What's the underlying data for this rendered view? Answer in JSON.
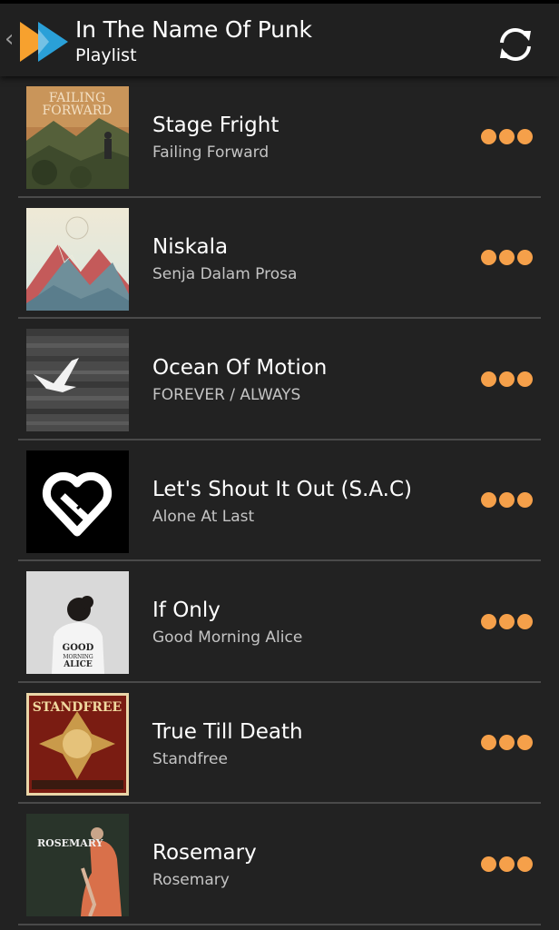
{
  "header": {
    "title": "In The Name Of Punk",
    "subtitle": "Playlist",
    "up_caret": "‹",
    "logo_icon": "app-logo-icon",
    "sync_icon": "sync-icon"
  },
  "colors": {
    "background": "#222222",
    "action_bar": "#202020",
    "accent_orange": "#f5a04a",
    "logo_orange": "#f7a12e",
    "logo_blue": "#2aa0d8",
    "divider": "#4a4a4a"
  },
  "tracks": [
    {
      "title": "Stage Fright",
      "artist": "Failing Forward",
      "art_text": [
        "FAILING",
        "FORWARD"
      ],
      "more_icon": "more-dots-icon"
    },
    {
      "title": "Niskala",
      "artist": "Senja Dalam Prosa",
      "more_icon": "more-dots-icon"
    },
    {
      "title": "Ocean Of Motion",
      "artist": "FOREVER / ALWAYS",
      "more_icon": "more-dots-icon"
    },
    {
      "title": "Let's Shout It Out (S.A.C)",
      "artist": "Alone At Last",
      "more_icon": "more-dots-icon"
    },
    {
      "title": "If Only",
      "artist": "Good Morning Alice",
      "art_text": [
        "GOOD",
        "MORNING",
        "ALICE"
      ],
      "more_icon": "more-dots-icon"
    },
    {
      "title": "True Till Death",
      "artist": "Standfree",
      "art_text": [
        "STANDFREE"
      ],
      "more_icon": "more-dots-icon"
    },
    {
      "title": "Rosemary",
      "artist": "Rosemary",
      "art_text": [
        "ROSEMARY"
      ],
      "more_icon": "more-dots-icon"
    }
  ]
}
